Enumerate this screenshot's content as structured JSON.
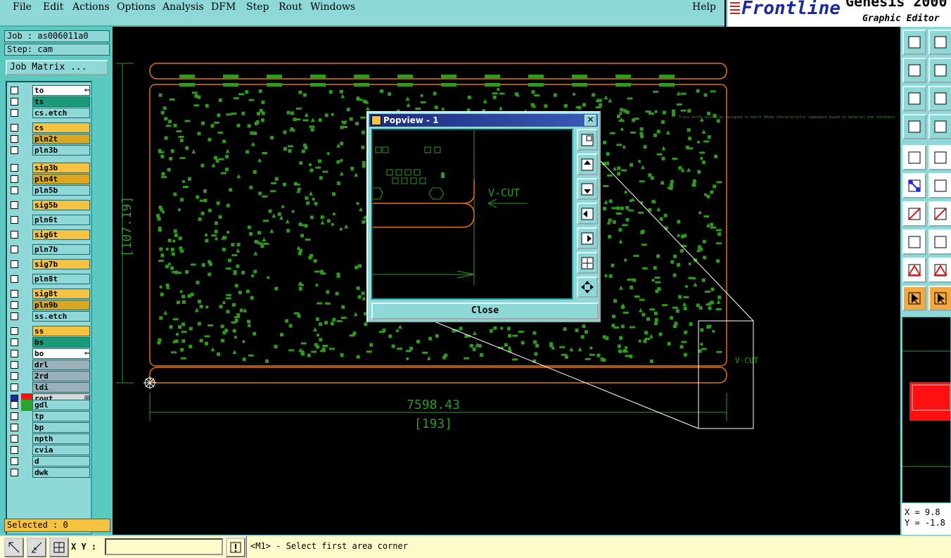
{
  "menu": [
    "File",
    "Edit",
    "Actions",
    "Options",
    "Analysis",
    "DFM",
    "Step",
    "Rout",
    "Windows"
  ],
  "help": "Help",
  "brand": {
    "name": "Frontline",
    "product": "Genesis 2000",
    "subtitle": "Graphic Editor"
  },
  "job": {
    "label": "Job : as006011a0",
    "step": "Step: cam",
    "matrix_button": "Job Matrix ..."
  },
  "layers": [
    {
      "name": "to",
      "color": "#ffffff",
      "group": 0,
      "row": 0,
      "marker": "⇐"
    },
    {
      "name": "ts",
      "color": "#1a9a78",
      "group": 0,
      "row": 1
    },
    {
      "name": "cs.etch",
      "color": "#8fd8d8",
      "group": 1,
      "row": 0
    },
    {
      "name": "cs",
      "color": "#f5c242",
      "group": 2,
      "row": 0
    },
    {
      "name": "pln2t",
      "color": "#d9a622",
      "group": 2,
      "row": 1
    },
    {
      "name": "pln3b",
      "color": "#8fd8d8",
      "group": 3,
      "row": 0
    },
    {
      "name": "sig3b",
      "color": "#f5c242",
      "group": 4,
      "row": 0
    },
    {
      "name": "pln4t",
      "color": "#d9a622",
      "group": 4,
      "row": 1
    },
    {
      "name": "pln5b",
      "color": "#8fd8d8",
      "group": 5,
      "row": 0
    },
    {
      "name": "sig5b",
      "color": "#f5c242",
      "group": 6,
      "row": 0
    },
    {
      "name": "pln6t",
      "color": "#8fd8d8",
      "group": 7,
      "row": 0
    },
    {
      "name": "sig6t",
      "color": "#f5c242",
      "group": 8,
      "row": 0
    },
    {
      "name": "pln7b",
      "color": "#8fd8d8",
      "group": 9,
      "row": 0
    },
    {
      "name": "sig7b",
      "color": "#f5c242",
      "group": 10,
      "row": 0
    },
    {
      "name": "pln8t",
      "color": "#8fd8d8",
      "group": 11,
      "row": 0
    },
    {
      "name": "sig8t",
      "color": "#f5c242",
      "group": 12,
      "row": 0
    },
    {
      "name": "pln9b",
      "color": "#d9a622",
      "group": 12,
      "row": 1
    },
    {
      "name": "ss.etch",
      "color": "#8fd8d8",
      "group": 13,
      "row": 0
    },
    {
      "name": "ss",
      "color": "#f5c242",
      "group": 14,
      "row": 0
    },
    {
      "name": "bs",
      "color": "#1a9a78",
      "group": 14,
      "row": 1
    },
    {
      "name": "bo",
      "color": "#ffffff",
      "group": 14,
      "row": 2,
      "marker": "⇐"
    },
    {
      "name": "drl",
      "color": "#9ab0bb",
      "group": 15,
      "row": 0
    },
    {
      "name": "2rd",
      "color": "#9ab0bb",
      "group": 15,
      "row": 1
    },
    {
      "name": "ldi",
      "color": "#9ab0bb",
      "group": 15,
      "row": 2
    },
    {
      "name": "rout",
      "color": "#d8d8d8",
      "group": 15,
      "row": 3,
      "swatch": "#ff1010",
      "checked_color": "#1a2a9a",
      "marker": "⊞"
    },
    {
      "name": "gdl",
      "color": "#8fd8d8",
      "group": 16,
      "row": 0,
      "swatch": "#2aa32a"
    },
    {
      "name": "tp",
      "color": "#8fd8d8",
      "group": 16,
      "row": 1
    },
    {
      "name": "bp",
      "color": "#8fd8d8",
      "group": 16,
      "row": 2
    },
    {
      "name": "npth",
      "color": "#8fd8d8",
      "group": 16,
      "row": 3
    },
    {
      "name": "cvia",
      "color": "#8fd8d8",
      "group": 16,
      "row": 4
    },
    {
      "name": "d",
      "color": "#8fd8d8",
      "group": 16,
      "row": 5
    },
    {
      "name": "dwk",
      "color": "#8fd8d8",
      "group": 16,
      "row": 6
    }
  ],
  "selected": "Selected : 0",
  "canvas": {
    "dim_horizontal": "7598.43",
    "dim_horizontal_mm": "[193]",
    "dim_vertical_mm": "[107.19]",
    "vcut_label": "V-CUT",
    "note_text": "Trace width should be designed to match 30ohm characteristic impedance based on material and thickness"
  },
  "popview": {
    "title": "Popview - 1",
    "close": "Close",
    "vcut_label": "V-CUT"
  },
  "coords": {
    "x": "X = 9.8",
    "y": "Y = -1.8"
  },
  "bottom": {
    "xy_label": "X Y :",
    "xy_value": "",
    "status": "<M1> - Select first area corner"
  }
}
